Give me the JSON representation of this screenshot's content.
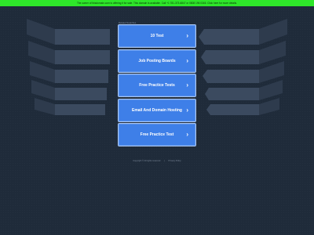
{
  "banner": {
    "text": "The owner of thisdomain.com is offering it for sale. This domain is available. Call +1 781-373-6847 or 0808 196 0345. Click here for more details."
  },
  "related_label": "Related Searches",
  "links": [
    {
      "label": "10 Test"
    },
    {
      "label": "Job Posting Boards"
    },
    {
      "label": "Free Practice Tests"
    },
    {
      "label": "Email And Domain Hosting"
    },
    {
      "label": "Free Practice Test"
    }
  ],
  "chevron_glyph": "›",
  "footer": {
    "copyright": "Copyright © All rights reserved",
    "separator": "|",
    "privacy": "Privacy Policy"
  },
  "colors": {
    "background": "#1f2b3a",
    "banner": "#2ee62a",
    "button": "#3e7fe8"
  }
}
